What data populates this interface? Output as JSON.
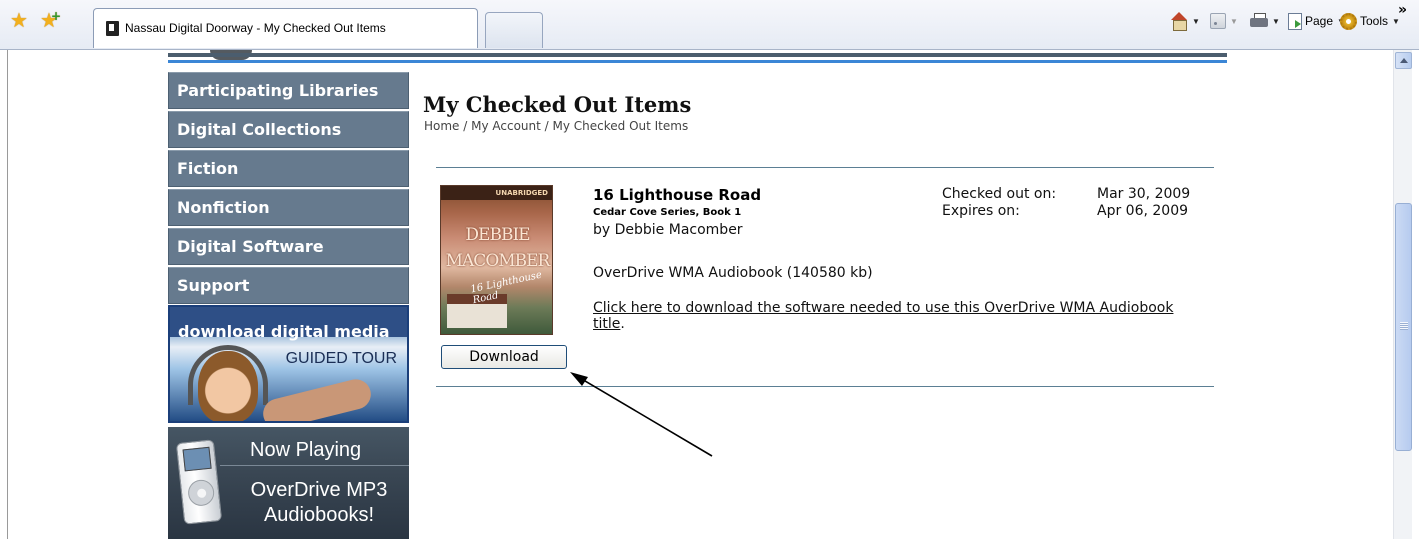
{
  "browser": {
    "tab_title": "Nassau Digital Doorway - My Checked Out Items",
    "commands": {
      "page": "Page",
      "tools": "Tools"
    }
  },
  "sidebar": {
    "items": [
      {
        "label": "Participating Libraries"
      },
      {
        "label": "Digital Collections"
      },
      {
        "label": "Fiction"
      },
      {
        "label": "Nonfiction"
      },
      {
        "label": "Digital Software"
      },
      {
        "label": "Support"
      }
    ],
    "promo_guided_tour": {
      "title": "download digital media",
      "subtitle": "GUIDED TOUR"
    },
    "promo_mp3": {
      "heading": "Now Playing",
      "line1": "OverDrive MP3",
      "line2": "Audiobooks!"
    }
  },
  "main": {
    "title": "My Checked Out Items",
    "breadcrumb": "Home / My Account / My Checked Out Items",
    "item": {
      "cover_author_line1": "DEBBIE",
      "cover_author_line2": "MACOMBER",
      "cover_badge": "UNABRIDGED",
      "cover_title": "16 Lighthouse Road",
      "title": "16 Lighthouse Road",
      "series": "Cedar Cove Series, Book 1",
      "author": "by Debbie Macomber",
      "format": "OverDrive WMA Audiobook (140580 kb)",
      "software_link_text": "Click here to download the software needed to use this OverDrive WMA Audiobook title",
      "software_link_suffix": ".",
      "checked_out_label": "Checked out on:",
      "checked_out_value": "Mar 30, 2009",
      "expires_label": "Expires on:",
      "expires_value": "Apr 06, 2009",
      "download_button": "Download"
    }
  },
  "colors": {
    "nav_bg": "#667a8e",
    "accent_rule": "#3b86d6",
    "divider": "#5b7f94"
  }
}
